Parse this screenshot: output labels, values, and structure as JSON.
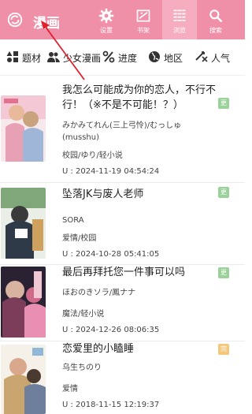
{
  "header": {
    "title": "漫画",
    "buttons": [
      {
        "label": "设置",
        "icon": "gear-icon"
      },
      {
        "label": "书架",
        "icon": "bookshelf-icon"
      },
      {
        "label": "浏览",
        "icon": "browse-grid-icon"
      },
      {
        "label": "搜索",
        "icon": "search-icon"
      }
    ],
    "color": "#f08fa8"
  },
  "filters": [
    {
      "label": "题材",
      "icon": "shapes-icon"
    },
    {
      "label": "少女漫画",
      "icon": "people-icon"
    },
    {
      "label": "进度",
      "icon": "percent-icon"
    },
    {
      "label": "地区",
      "icon": "globe-icon"
    },
    {
      "label": "人气",
      "icon": "popularity-icon"
    }
  ],
  "comics": [
    {
      "title": "我怎么可能成为你的恋人，不行不行！（※不是不可能！？）",
      "author": "みかみてれん(三上弓怜)/むっしゅ(musshu)",
      "tags": "校园/ゆり/轻小说",
      "updated": "U : 2024-11-19 04:54:24",
      "badge": "更",
      "badge_color": "#9ad29a"
    },
    {
      "title": "坠落JK与废人老师",
      "author": "SORA",
      "tags": "爱情/校园",
      "updated": "U : 2024-10-28 05:41:05",
      "badge": "更",
      "badge_color": "#9ad29a"
    },
    {
      "title": "最后再拜托您一件事可以吗",
      "author": "ほおのきソラ/鳳ナナ",
      "tags": "魔法/轻小说",
      "updated": "U : 2024-12-26 08:06:35",
      "badge": "更",
      "badge_color": "#9ad29a"
    },
    {
      "title": "恋爱里的小瞌睡",
      "author": "乌生ちのり",
      "tags": "爱情",
      "updated": "U : 2018-11-15 12:19:37",
      "badge": "完",
      "badge_color": "#f5c77a"
    }
  ]
}
